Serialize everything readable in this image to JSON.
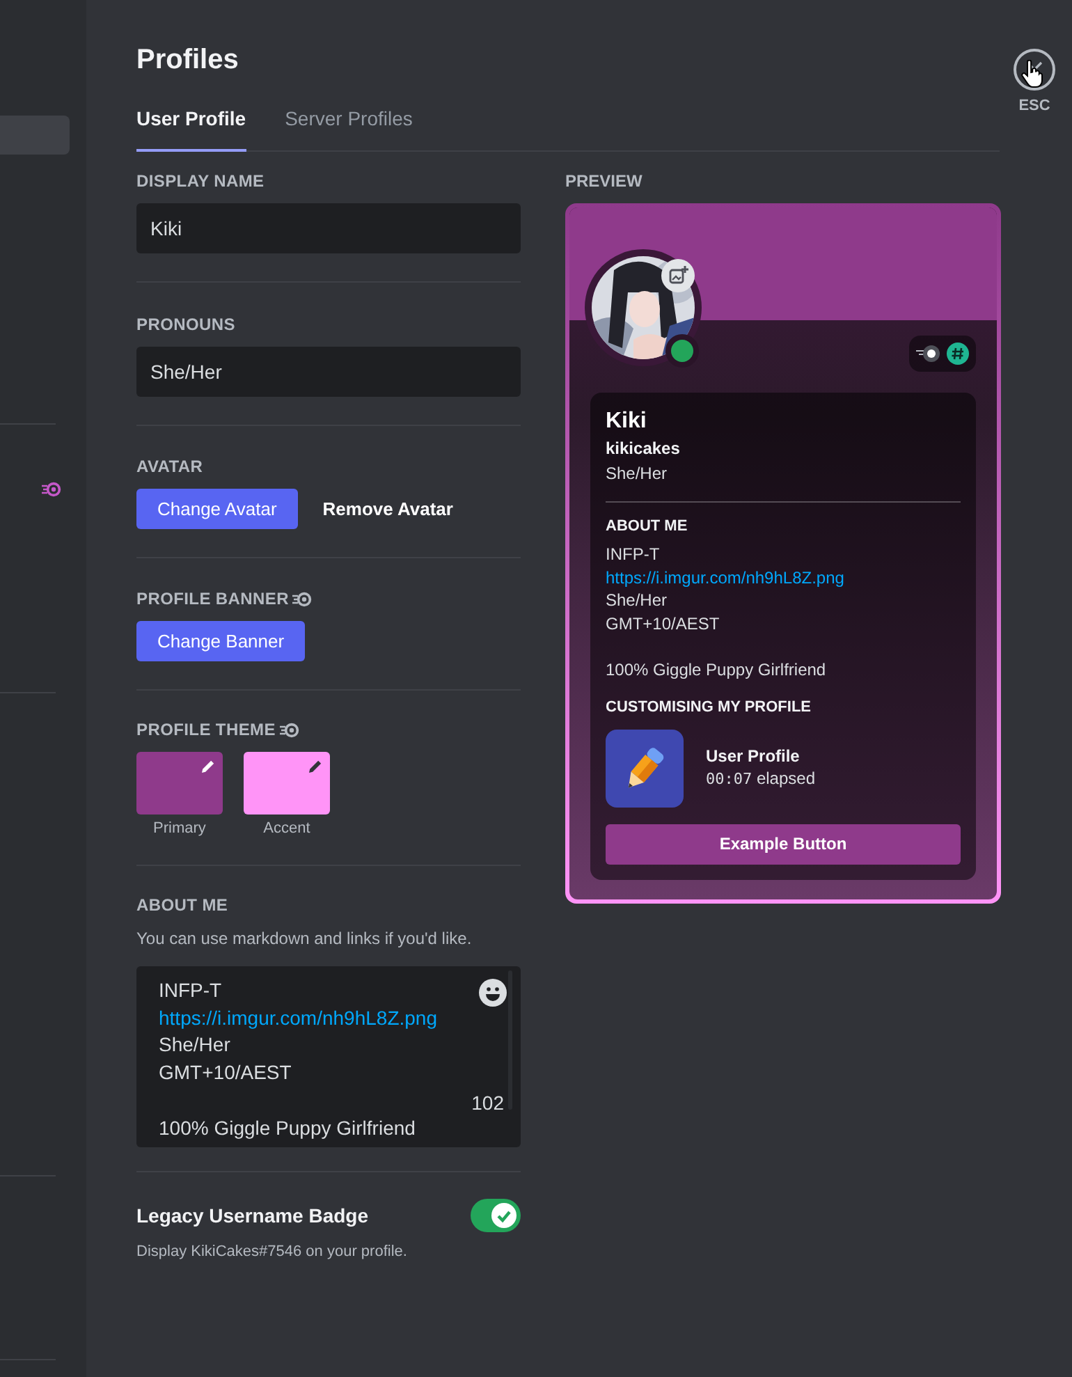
{
  "sidebar": {
    "items": [
      {
        "selected": true
      }
    ]
  },
  "title": "Profiles",
  "close": {
    "label": "ESC"
  },
  "tabs": [
    {
      "label": "User Profile",
      "selected": true
    },
    {
      "label": "Server Profiles",
      "selected": false
    }
  ],
  "form": {
    "display_name": {
      "label": "DISPLAY NAME",
      "value": "Kiki"
    },
    "pronouns": {
      "label": "PRONOUNS",
      "value": "She/Her"
    },
    "avatar": {
      "label": "AVATAR",
      "buttons": [
        {
          "label": "Change Avatar",
          "kind": "primary"
        },
        {
          "label": "Remove Avatar",
          "kind": "link"
        }
      ]
    },
    "banner": {
      "label": "PROFILE BANNER",
      "nitro": true,
      "buttons": [
        {
          "label": "Change Banner",
          "kind": "primary"
        }
      ]
    },
    "theme": {
      "label": "PROFILE THEME",
      "nitro": true,
      "swatches": [
        {
          "label": "Primary",
          "color": "#8f3a8b"
        },
        {
          "label": "Accent",
          "color": "#ff94f7"
        }
      ]
    },
    "about": {
      "label": "ABOUT ME",
      "hint": "You can use markdown and links if you'd like.",
      "counter": "102",
      "paragraphs": [
        {
          "lines": [
            {
              "text": "INFP-T",
              "kind": "text"
            },
            {
              "text": "https://i.imgur.com/nh9hL8Z.png",
              "kind": "link"
            },
            {
              "text": "She/Her",
              "kind": "text"
            },
            {
              "text": "GMT+10/AEST",
              "kind": "text"
            }
          ]
        },
        {
          "lines": [
            {
              "text": "100% Giggle Puppy Girlfriend",
              "kind": "text"
            }
          ]
        }
      ]
    },
    "legacy_badge": {
      "label": "Legacy Username Badge",
      "description": "Display KikiCakes#7546 on your profile.",
      "on": true
    }
  },
  "preview": {
    "label": "PREVIEW",
    "online": true,
    "display_name": "Kiki",
    "username": "kikicakes",
    "pronouns": "She/Her",
    "about_label": "ABOUT ME",
    "about_paragraphs": [
      {
        "lines": [
          {
            "text": "INFP-T",
            "kind": "text"
          },
          {
            "text": "https://i.imgur.com/nh9hL8Z.png",
            "kind": "link"
          },
          {
            "text": "She/Her",
            "kind": "text"
          },
          {
            "text": "GMT+10/AEST",
            "kind": "text"
          }
        ]
      },
      {
        "lines": [
          {
            "text": "100% Giggle Puppy Girlfriend",
            "kind": "text"
          }
        ]
      }
    ],
    "activity": {
      "label": "CUSTOMISING MY PROFILE",
      "title": "User Profile",
      "timer": "00:07",
      "suffix": "elapsed"
    },
    "button": "Example Button"
  }
}
